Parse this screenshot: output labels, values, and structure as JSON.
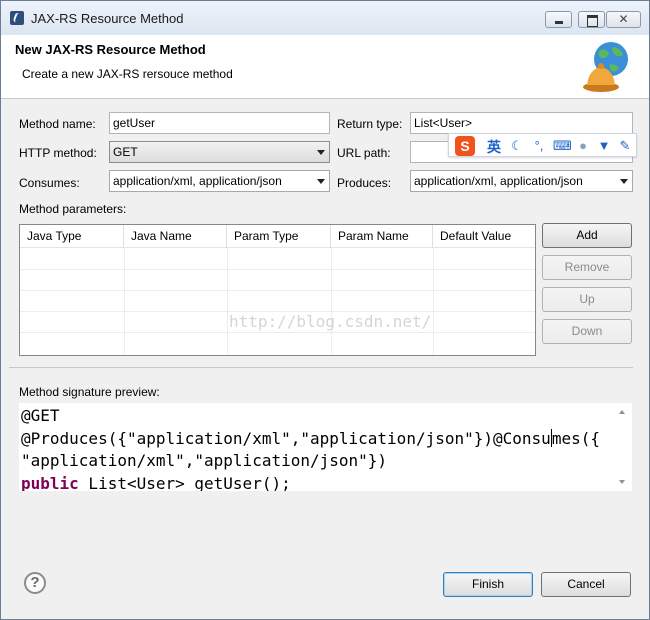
{
  "window": {
    "title": "JAX-RS Resource Method"
  },
  "banner": {
    "title": "New JAX-RS Resource Method",
    "subtitle": "Create a new JAX-RS rersouce method"
  },
  "form": {
    "method_name_label": "Method name:",
    "method_name_value": "getUser",
    "return_type_label": "Return type:",
    "return_type_value": "List<User>",
    "http_method_label": "HTTP method:",
    "http_method_value": "GET",
    "url_path_label": "URL path:",
    "url_path_value": "",
    "consumes_label": "Consumes:",
    "consumes_value": "application/xml, application/json",
    "produces_label": "Produces:",
    "produces_value": "application/xml, application/json"
  },
  "ime": {
    "logo": "S",
    "lang": "英"
  },
  "parameters": {
    "label": "Method parameters:",
    "columns": [
      "Java Type",
      "Java Name",
      "Param Type",
      "Param Name",
      "Default Value"
    ],
    "rows": []
  },
  "param_buttons": {
    "add": "Add",
    "remove": "Remove",
    "up": "Up",
    "down": "Down"
  },
  "watermark": "http://blog.csdn.net/",
  "preview": {
    "label": "Method signature preview:",
    "line1": "@GET",
    "line2a": "@Produces({\"application/xml\",\"application/json\"})@Consu",
    "line2b": "mes({",
    "line3": "\"application/xml\",\"application/json\"})",
    "line4_keyword": "public",
    "line4_rest": " List<User> getUser();"
  },
  "footer": {
    "help": "?",
    "finish": "Finish",
    "cancel": "Cancel"
  }
}
